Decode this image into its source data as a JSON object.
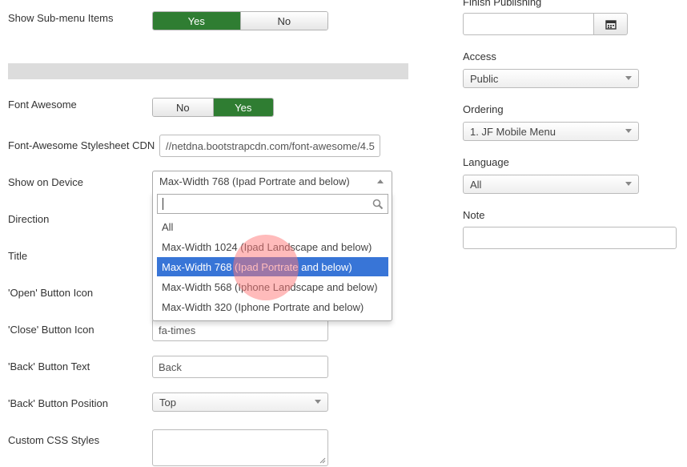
{
  "left_form": {
    "show_submenu": {
      "label": "Show Sub-menu Items",
      "yes": "Yes",
      "no": "No",
      "value": "Yes"
    },
    "font_awesome": {
      "label": "Font Awesome",
      "no": "No",
      "yes": "Yes",
      "value": "Yes"
    },
    "fa_cdn": {
      "label": "Font-Awesome Stylesheet CDN",
      "value": "//netdna.bootstrapcdn.com/font-awesome/4.5"
    },
    "show_on_device": {
      "label": "Show on Device",
      "value": "Max-Width 768 (Ipad Portrate and below)",
      "search_value": "",
      "options": [
        "All",
        "Max-Width 1024 (Ipad Landscape and below)",
        "Max-Width 768 (Ipad Portrate and below)",
        "Max-Width 568 (Iphone Landscape and below)",
        "Max-Width 320 (Iphone Portrate and below)"
      ],
      "highlighted_option": "Max-Width 768 (Ipad Portrate and below)"
    },
    "direction": {
      "label": "Direction"
    },
    "title": {
      "label": "Title"
    },
    "open_icon": {
      "label": "'Open' Button Icon"
    },
    "close_icon": {
      "label": "'Close' Button Icon",
      "value": "fa-times"
    },
    "back_text": {
      "label": "'Back' Button Text",
      "value": "Back"
    },
    "back_position": {
      "label": "'Back' Button Position",
      "value": "Top"
    },
    "custom_css": {
      "label": "Custom CSS Styles",
      "value": ""
    }
  },
  "right_form": {
    "finish_publishing": {
      "label": "Finish Publishing",
      "value": ""
    },
    "access": {
      "label": "Access",
      "value": "Public"
    },
    "ordering": {
      "label": "Ordering",
      "value": "1. JF Mobile Menu"
    },
    "language": {
      "label": "Language",
      "value": "All"
    },
    "note": {
      "label": "Note",
      "value": ""
    }
  },
  "icons": {
    "calendar": "calendar-icon",
    "search": "search-icon",
    "caret": "chevron-down-icon"
  },
  "colors": {
    "toggle_active": "#2f7d32",
    "option_highlight": "#3875d7",
    "click_marker": "#ff7878"
  }
}
